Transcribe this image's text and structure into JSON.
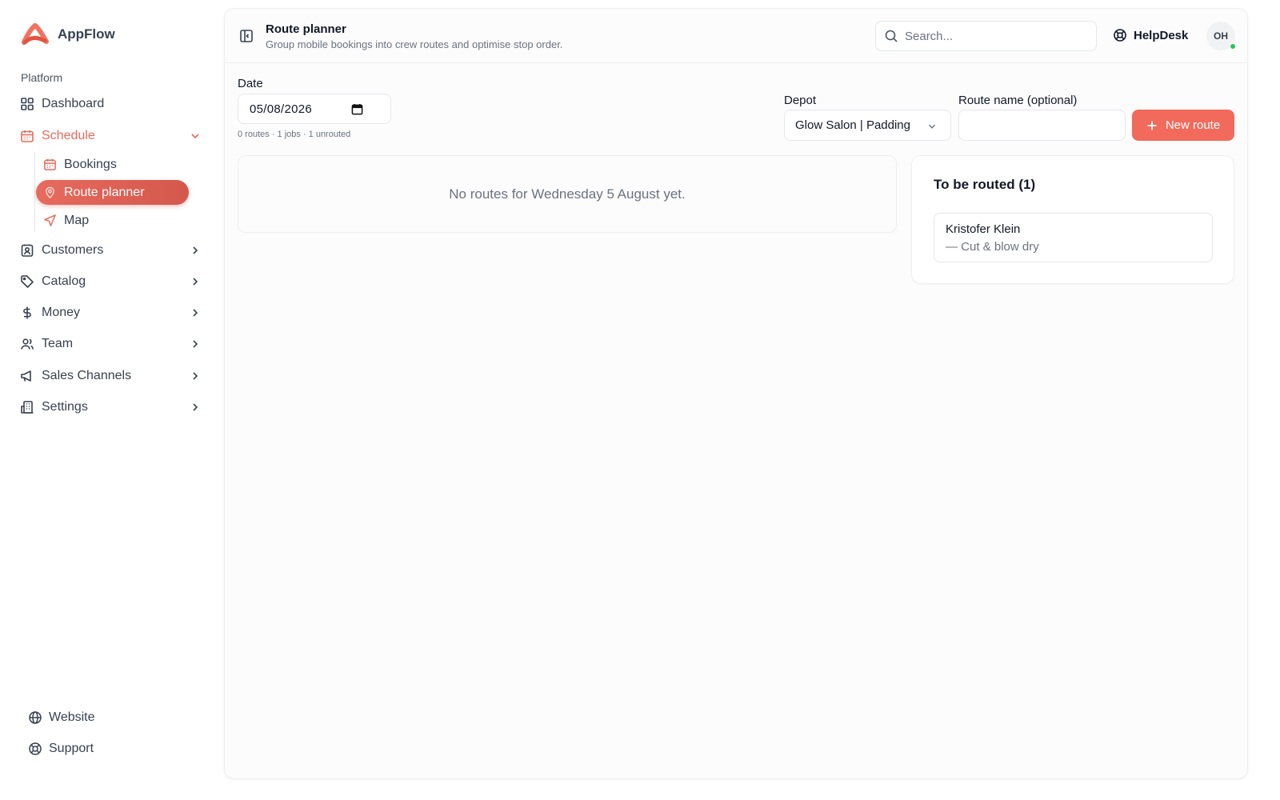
{
  "app": {
    "name": "AppFlow"
  },
  "sidebar": {
    "section_label": "Platform",
    "items": [
      {
        "label": "Dashboard",
        "icon": "dashboard-grid-icon"
      },
      {
        "label": "Schedule",
        "icon": "calendar-icon",
        "expanded": true,
        "children": [
          {
            "label": "Bookings",
            "icon": "calendar-icon"
          },
          {
            "label": "Route planner",
            "icon": "map-pin-icon",
            "active": true
          },
          {
            "label": "Map",
            "icon": "navigation-arrow-icon"
          }
        ]
      },
      {
        "label": "Customers",
        "icon": "contact-card-icon"
      },
      {
        "label": "Catalog",
        "icon": "tag-icon"
      },
      {
        "label": "Money",
        "icon": "dollar-icon"
      },
      {
        "label": "Team",
        "icon": "users-icon"
      },
      {
        "label": "Sales Channels",
        "icon": "megaphone-icon"
      },
      {
        "label": "Settings",
        "icon": "building-icon"
      }
    ],
    "footer": [
      {
        "label": "Website",
        "icon": "globe-icon"
      },
      {
        "label": "Support",
        "icon": "lifebuoy-icon"
      }
    ]
  },
  "header": {
    "title": "Route planner",
    "subtitle": "Group mobile bookings into crew routes and optimise stop order.",
    "search_placeholder": "Search...",
    "helpdesk_label": "HelpDesk",
    "avatar_initials": "OH"
  },
  "form": {
    "date_label": "Date",
    "date_value": "05/08/2026",
    "summary": "0 routes · 1 jobs · 1 unrouted",
    "depot_label": "Depot",
    "depot_value": "Glow Salon | Padding",
    "route_name_label": "Route name (optional)",
    "route_name_value": "",
    "new_route_label": "New route"
  },
  "routes": {
    "empty_message": "No routes for Wednesday 5 August yet."
  },
  "unrouted": {
    "title": "To be routed (1)",
    "jobs": [
      {
        "customer": "Kristofer Klein",
        "service": "— Cut & blow dry"
      }
    ]
  },
  "colors": {
    "accent": "#f26a5b",
    "accent_active_nav": "#e76a5e",
    "online_status": "#22c55e"
  }
}
